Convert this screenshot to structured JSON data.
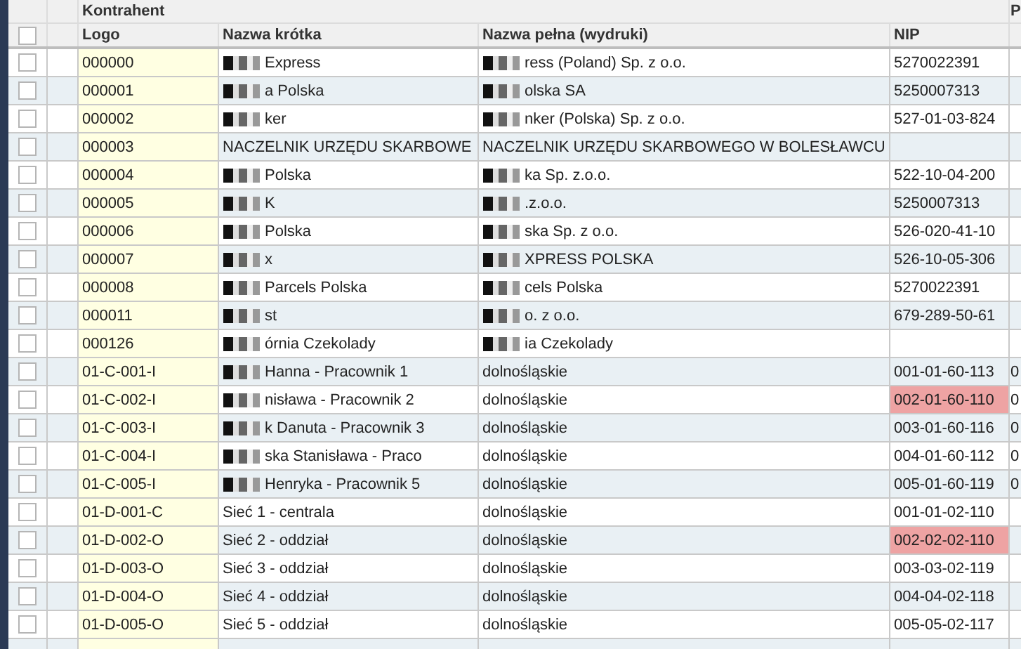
{
  "table": {
    "group_headers": [
      "Kontrahent",
      "P"
    ],
    "header_checkbox": {
      "checked": false
    },
    "columns": [
      "Logo",
      "Nazwa krótka",
      "Nazwa pełna (wydruki)",
      "NIP"
    ],
    "rows": [
      {
        "checked": false,
        "logo": "000000",
        "short_name": "Express",
        "short_redacted": true,
        "full_name": "ress (Poland) Sp. z o.o.",
        "full_redacted": true,
        "nip": "5270022391",
        "nip_flagged": false
      },
      {
        "checked": false,
        "logo": "000001",
        "short_name": "a Polska",
        "short_redacted": true,
        "full_name": "olska SA",
        "full_redacted": true,
        "nip": "5250007313",
        "nip_flagged": false
      },
      {
        "checked": false,
        "logo": "000002",
        "short_name": "ker",
        "short_redacted": true,
        "full_name": "nker (Polska) Sp. z o.o.",
        "full_redacted": true,
        "nip": "527-01-03-824",
        "nip_flagged": false
      },
      {
        "checked": false,
        "logo": "000003",
        "short_name": "NACZELNIK URZĘDU SKARBOWE",
        "short_redacted": false,
        "full_name": "NACZELNIK URZĘDU SKARBOWEGO W BOLESŁAWCU",
        "full_redacted": false,
        "nip_flagged": false
      },
      {
        "checked": false,
        "logo": "000004",
        "short_name": "Polska",
        "short_redacted": true,
        "full_name": "ka Sp. z.o.o.",
        "full_redacted": true,
        "nip": "522-10-04-200",
        "nip_flagged": false
      },
      {
        "checked": false,
        "logo": "000005",
        "short_name": "K",
        "short_redacted": true,
        "full_name": ".z.o.o.",
        "full_redacted": true,
        "nip": "5250007313",
        "nip_flagged": false
      },
      {
        "checked": false,
        "logo": "000006",
        "short_name": "Polska",
        "short_redacted": true,
        "full_name": "ska Sp. z o.o.",
        "full_redacted": true,
        "nip": "526-020-41-10",
        "nip_flagged": false
      },
      {
        "checked": false,
        "logo": "000007",
        "short_name": "x",
        "short_redacted": true,
        "full_name": "XPRESS POLSKA",
        "full_redacted": true,
        "nip": "526-10-05-306",
        "nip_flagged": false
      },
      {
        "checked": false,
        "logo": "000008",
        "short_name": "Parcels Polska",
        "short_redacted": true,
        "full_name": "cels Polska",
        "full_redacted": true,
        "nip": "5270022391",
        "nip_flagged": false
      },
      {
        "checked": false,
        "logo": "000011",
        "short_name": "st",
        "short_redacted": true,
        "full_name": "o. z o.o.",
        "full_redacted": true,
        "nip": "679-289-50-61",
        "nip_flagged": false
      },
      {
        "checked": false,
        "logo": "000126",
        "short_name": "órnia Czekolady",
        "short_redacted": true,
        "full_name": "ia Czekolady",
        "full_redacted": true,
        "nip_flagged": false
      },
      {
        "checked": false,
        "logo": "01-C-001-I",
        "short_name": "Hanna - Pracownik 1",
        "short_redacted": true,
        "full_name": "dolnośląskie",
        "full_redacted": false,
        "nip": "001-01-60-113",
        "nip_flagged": false,
        "column_6": "0"
      },
      {
        "checked": false,
        "logo": "01-C-002-I",
        "short_name": "nisława - Pracownik 2",
        "short_redacted": true,
        "full_name": "dolnośląskie",
        "full_redacted": false,
        "nip": "002-01-60-110",
        "nip_flagged": true,
        "column_6": "0"
      },
      {
        "checked": false,
        "logo": "01-C-003-I",
        "short_name": "k Danuta - Pracownik 3",
        "short_redacted": true,
        "full_name": "dolnośląskie",
        "full_redacted": false,
        "nip": "003-01-60-116",
        "nip_flagged": false,
        "column_6": "0"
      },
      {
        "checked": false,
        "logo": "01-C-004-I",
        "short_name": "ska Stanisława - Praco",
        "short_redacted": true,
        "full_name": "dolnośląskie",
        "full_redacted": false,
        "nip": "004-01-60-112",
        "nip_flagged": false,
        "column_6": "0"
      },
      {
        "checked": false,
        "logo": "01-C-005-I",
        "short_name": "Henryka - Pracownik 5",
        "short_redacted": true,
        "full_name": "dolnośląskie",
        "full_redacted": false,
        "nip": "005-01-60-119",
        "nip_flagged": false,
        "column_6": "0"
      },
      {
        "checked": false,
        "logo": "01-D-001-C",
        "short_name": "Sieć 1 - centrala",
        "short_redacted": false,
        "full_name": "dolnośląskie",
        "full_redacted": false,
        "nip": "001-01-02-110",
        "nip_flagged": false
      },
      {
        "checked": false,
        "logo": "01-D-002-O",
        "short_name": "Sieć 2 - oddział",
        "short_redacted": false,
        "full_name": "dolnośląskie",
        "full_redacted": false,
        "nip": "002-02-02-110",
        "nip_flagged": true
      },
      {
        "checked": false,
        "logo": "01-D-003-O",
        "short_name": "Sieć 3 - oddział",
        "short_redacted": false,
        "full_name": "dolnośląskie",
        "full_redacted": false,
        "nip": "003-03-02-119",
        "nip_flagged": false
      },
      {
        "checked": false,
        "logo": "01-D-004-O",
        "short_name": "Sieć 4 - oddział",
        "short_redacted": false,
        "full_name": "dolnośląskie",
        "full_redacted": false,
        "nip": "004-04-02-118",
        "nip_flagged": false
      },
      {
        "checked": false,
        "logo": "01-D-005-O",
        "short_name": "Sieć 5 - oddział",
        "short_redacted": false,
        "full_name": "dolnośląskie",
        "full_redacted": false,
        "nip": "005-05-02-117",
        "nip_flagged": false
      }
    ]
  }
}
